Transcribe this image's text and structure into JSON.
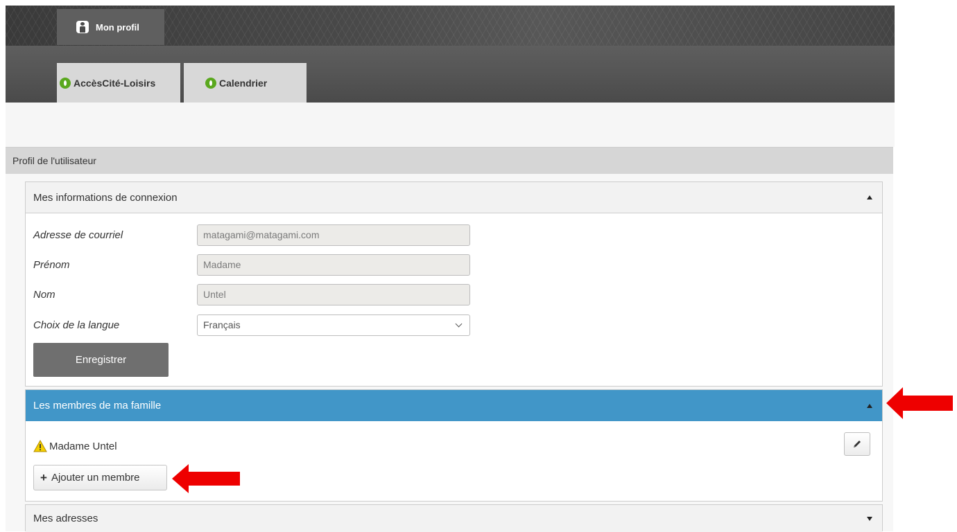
{
  "header": {
    "profile_tab_label": "Mon profil",
    "nav_tabs": [
      {
        "label": "AccèsCité-Loisirs",
        "icon": "leaf-icon"
      },
      {
        "label": "Calendrier",
        "icon": "leaf-icon"
      }
    ]
  },
  "section": {
    "title": "Profil de l'utilisateur"
  },
  "login_panel": {
    "title": "Mes informations de connexion",
    "fields": {
      "email": {
        "label": "Adresse de courriel",
        "value": "matagami@matagami.com"
      },
      "first_name": {
        "label": "Prénom",
        "value": "Madame"
      },
      "last_name": {
        "label": "Nom",
        "value": "Untel"
      },
      "language": {
        "label": "Choix de la langue",
        "value": "Français"
      }
    },
    "save_label": "Enregistrer"
  },
  "family_panel": {
    "title": "Les membres de ma famille",
    "members": [
      {
        "name": "Madame Untel",
        "status_icon": "warning-icon"
      }
    ],
    "add_member_label": "Ajouter un membre"
  },
  "address_panel": {
    "title": "Mes adresses"
  },
  "colors": {
    "accent_blue": "#4196c8",
    "save_button": "#6f6f6f",
    "annotation_arrow": "#ee0000",
    "leaf_green": "#5aa81e"
  }
}
